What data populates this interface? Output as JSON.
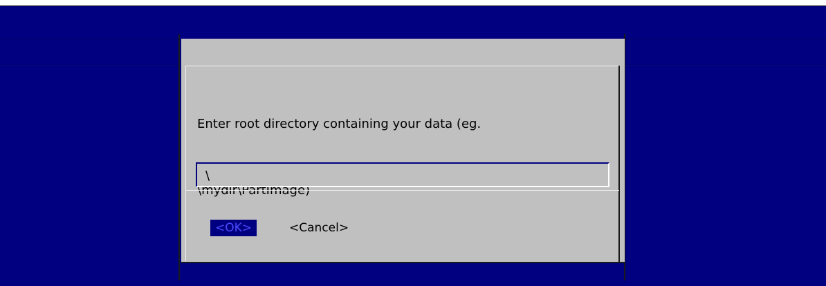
{
  "colors": {
    "screen_background": "#000080",
    "dialog_background": "#c0c0c0",
    "highlight_background": "#000080",
    "highlight_text": "#4b4bff",
    "text": "#000000"
  },
  "dialog": {
    "prompt_line_1": "Enter root directory containing your data (eg.",
    "prompt_line_2": "\\mydir\\PartImage)",
    "input_value": "\\",
    "buttons": {
      "ok_label": "<OK>",
      "cancel_label": "<Cancel>"
    }
  }
}
